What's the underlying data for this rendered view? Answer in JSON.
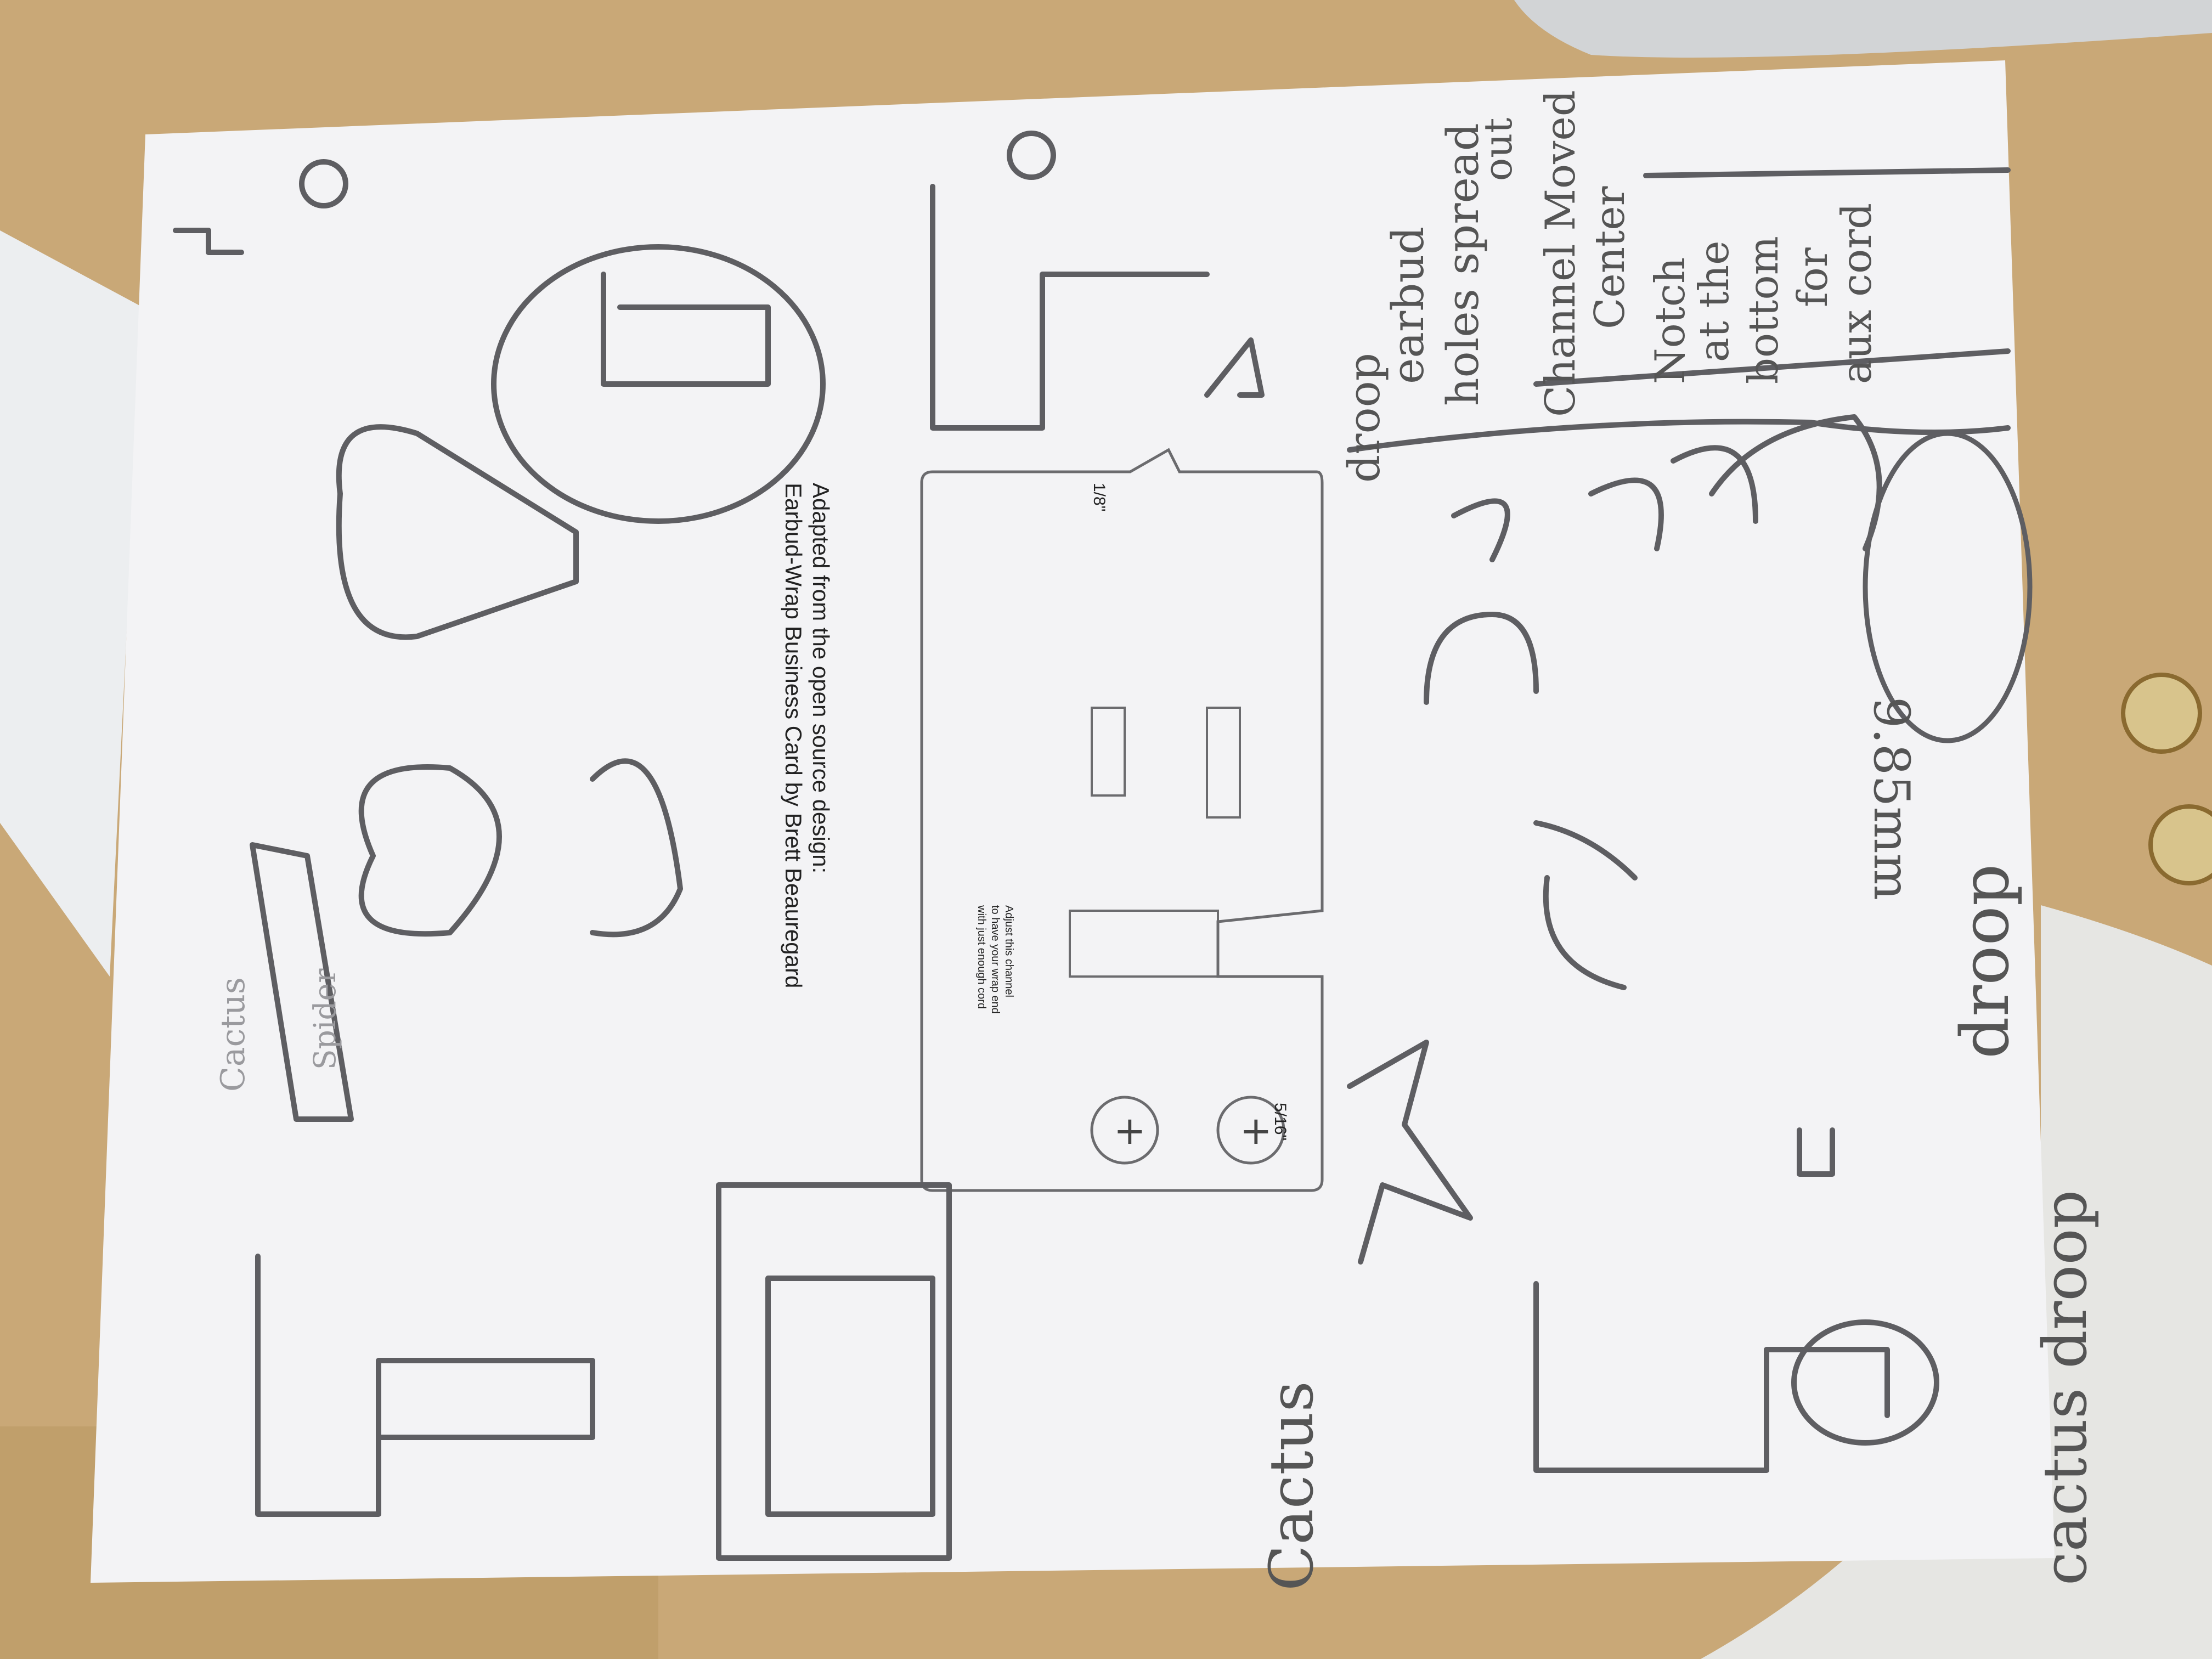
{
  "colors": {
    "table": "#c9a877",
    "paper": "#f3f3f5",
    "pencil": "#5e5e62",
    "print": "#6b6b6e",
    "cloth": "#e6e6e3"
  },
  "print_text": {
    "credit_line_1": "Adapted from the open source design:",
    "credit_line_2": "Earbud-Wrap Business Card by Brett Beauregard",
    "dim_1_8": "1/8\"",
    "dim_5_16": "5/16\"",
    "channel_note_1": "Adjust this channel",
    "channel_note_2": "to have your wrap end",
    "channel_note_3": "with just enough cord"
  },
  "handwriting": {
    "cactus": "Cactus",
    "cactus_droop": "cactus droop",
    "droop_top": "droop",
    "droop_label": "droop",
    "earbud_line_1": "earbud",
    "earbud_line_2": "holes spread",
    "earbud_line_3": "out",
    "channel_line_1": "Channel Moved",
    "channel_line_2": "Center",
    "notch_line_1": "Notch",
    "notch_line_2": "at the",
    "notch_line_3": "bottom",
    "notch_line_4": "for",
    "notch_line_5": "aux cord",
    "measurement": "9.85mm",
    "side_note_1": "Cactus",
    "side_note_2": "Spider"
  }
}
